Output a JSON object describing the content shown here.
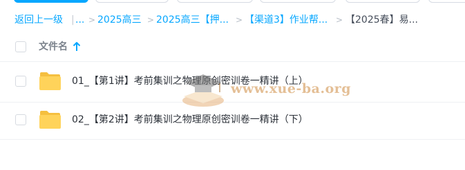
{
  "breadcrumb": {
    "back": "返回上一级",
    "divider": "|",
    "ellipsis": "...",
    "items": [
      "2025高三",
      "2025高三【押...",
      "【渠道3】作业帮...",
      "【2025春】易..."
    ]
  },
  "list_header": {
    "name_label": "文件名",
    "sort_direction": "ascending"
  },
  "files": [
    {
      "name": "01_【第1讲】考前集训之物理原创密训卷一精讲（上）",
      "type": "folder"
    },
    {
      "name": "02_【第2讲】考前集训之物理原创密训卷一精讲（下）",
      "type": "folder"
    }
  ],
  "watermark": {
    "text": "www.xue-ba.org"
  },
  "colors": {
    "accent": "#06a7ff",
    "folder": "#ffd35a",
    "folder_back": "#f5bf3f",
    "text_primary": "#2b3038",
    "text_muted": "#7b828c",
    "watermark": "#d9a56a"
  }
}
